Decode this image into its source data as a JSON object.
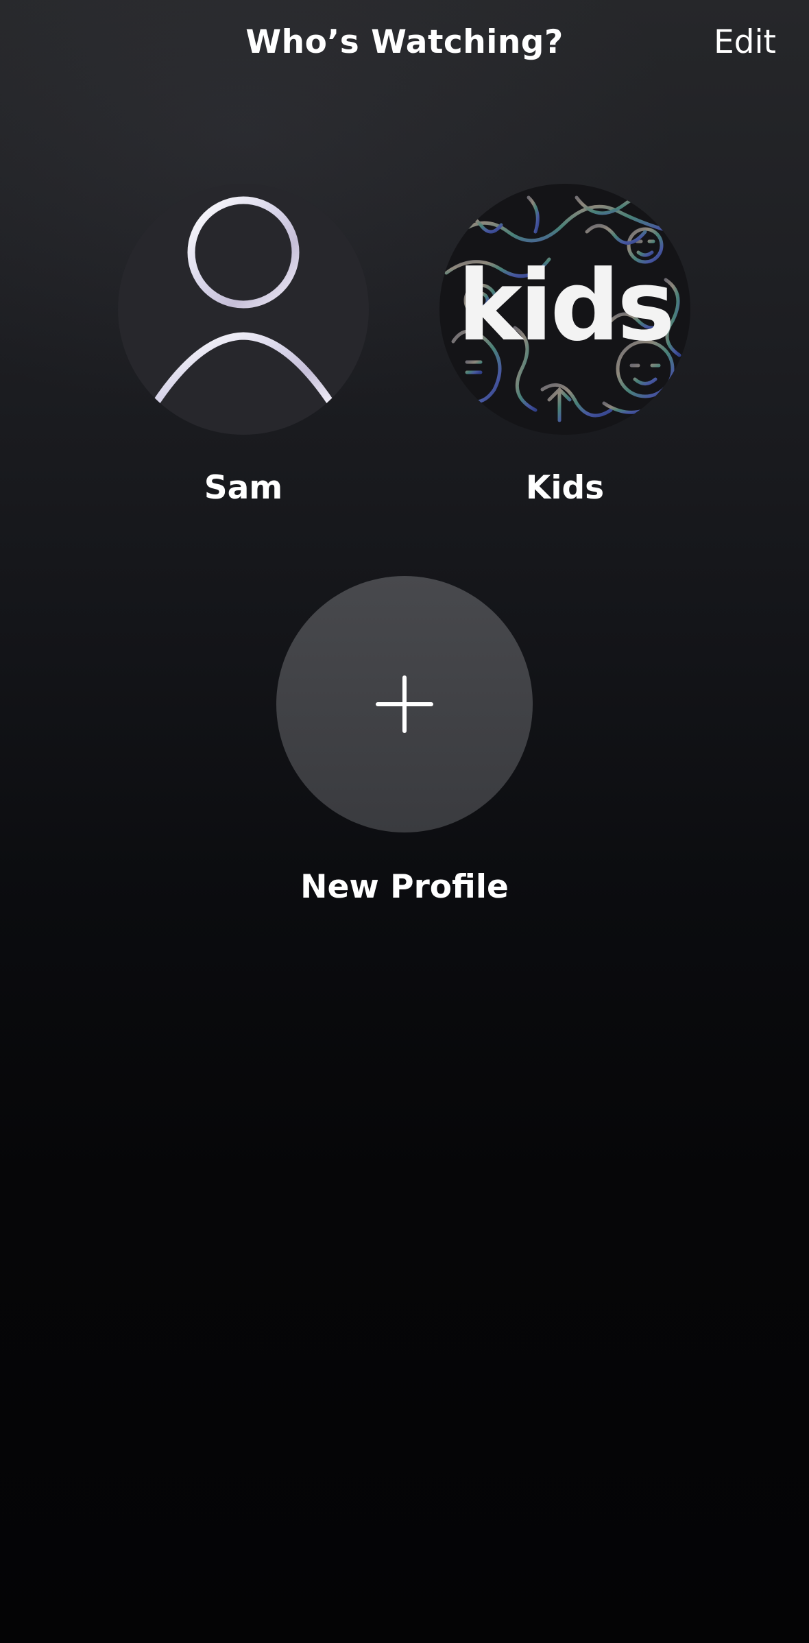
{
  "header": {
    "title": "Who’s Watching?",
    "edit_label": "Edit"
  },
  "profiles": [
    {
      "name": "Sam",
      "avatar_icon": "person-icon"
    },
    {
      "name": "Kids",
      "avatar_icon": "kids-logo",
      "logo_text": "kids"
    }
  ],
  "new_profile": {
    "label": "New Profile",
    "icon": "plus-icon"
  },
  "colors": {
    "background_top": "#26272a",
    "background_bottom": "#040405",
    "text": "#ffffff",
    "new_profile_circle": "#48494d"
  }
}
